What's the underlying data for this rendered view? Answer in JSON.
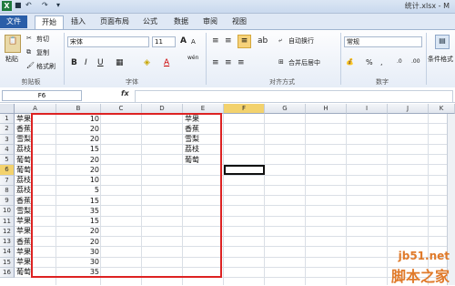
{
  "window": {
    "app_icon": "X",
    "title": "统计.xlsx - M",
    "quick_access": [
      "save-icon",
      "undo-icon",
      "redo-icon",
      "customize-icon"
    ]
  },
  "tabs": [
    {
      "label": "文件"
    },
    {
      "label": "开始"
    },
    {
      "label": "插入"
    },
    {
      "label": "页面布局"
    },
    {
      "label": "公式"
    },
    {
      "label": "数据"
    },
    {
      "label": "审阅"
    },
    {
      "label": "视图"
    }
  ],
  "ribbon": {
    "clipboard": {
      "paste": "粘贴",
      "cut": "剪切",
      "copy": "复制",
      "format_painter": "格式刷",
      "group": "剪贴板"
    },
    "font": {
      "name": "宋体",
      "size": "11",
      "grow": "A",
      "shrink": "A",
      "bold": "B",
      "italic": "I",
      "underline": "U",
      "color_letter": "A",
      "wen": "wén",
      "group": "字体"
    },
    "alignment": {
      "wrap": "自动换行",
      "merge": "合并后居中",
      "group": "对齐方式"
    },
    "number": {
      "format": "常规",
      "percent": "%",
      "comma": ",",
      "group": "数字"
    },
    "styles": {
      "conditional": "条件格式"
    }
  },
  "formula_bar": {
    "name_box": "F6",
    "fx": "fx",
    "value": ""
  },
  "columns": [
    "A",
    "B",
    "C",
    "D",
    "E",
    "F",
    "G",
    "H",
    "I",
    "J",
    "K"
  ],
  "selected_column": "F",
  "selected_row": 6,
  "rows": [
    {
      "n": "1",
      "a": "苹果",
      "b": "10",
      "e": "苹果"
    },
    {
      "n": "2",
      "a": "香蕉",
      "b": "20",
      "e": "香蕉"
    },
    {
      "n": "3",
      "a": "雪梨",
      "b": "20",
      "e": "雪梨"
    },
    {
      "n": "4",
      "a": "荔枝",
      "b": "15",
      "e": "荔枝"
    },
    {
      "n": "5",
      "a": "葡萄",
      "b": "20",
      "e": "葡萄"
    },
    {
      "n": "6",
      "a": "葡萄",
      "b": "20",
      "e": ""
    },
    {
      "n": "7",
      "a": "荔枝",
      "b": "10",
      "e": ""
    },
    {
      "n": "8",
      "a": "荔枝",
      "b": "5",
      "e": ""
    },
    {
      "n": "9",
      "a": "香蕉",
      "b": "15",
      "e": ""
    },
    {
      "n": "10",
      "a": "雪梨",
      "b": "35",
      "e": ""
    },
    {
      "n": "11",
      "a": "苹果",
      "b": "15",
      "e": ""
    },
    {
      "n": "12",
      "a": "苹果",
      "b": "20",
      "e": ""
    },
    {
      "n": "13",
      "a": "香蕉",
      "b": "20",
      "e": ""
    },
    {
      "n": "14",
      "a": "苹果",
      "b": "30",
      "e": ""
    },
    {
      "n": "15",
      "a": "苹果",
      "b": "30",
      "e": ""
    },
    {
      "n": "16",
      "a": "葡萄",
      "b": "35",
      "e": ""
    }
  ],
  "watermark": {
    "line1": "jb51.net",
    "line2": "脚本之家"
  },
  "colors": {
    "highlight_border": "#dd2222",
    "file_tab": "#2a5ea8",
    "selected_header": "#f3d26d"
  }
}
